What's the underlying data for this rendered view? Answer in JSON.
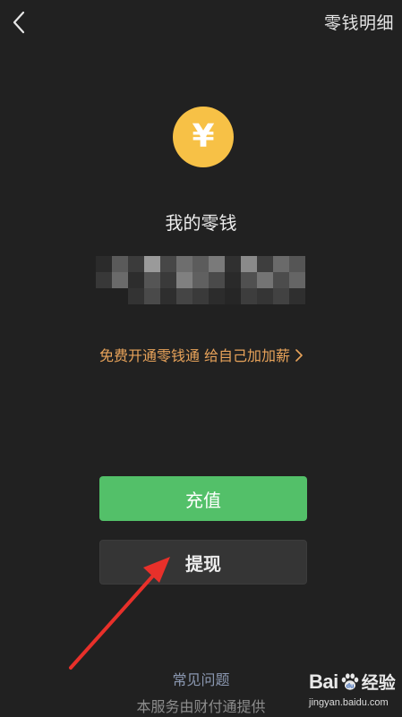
{
  "header": {
    "back_icon": "chevron-left-icon",
    "title": "零钱明细"
  },
  "balance": {
    "coin_symbol": "¥",
    "coin_color": "#f7c146",
    "title": "我的零钱",
    "amount_hidden": true
  },
  "promo": {
    "text": "免费开通零钱通 给自己加加薪",
    "chevron": "›",
    "color": "#e8a35a"
  },
  "actions": {
    "recharge_label": "充值",
    "withdraw_label": "提现",
    "recharge_color": "#53c069"
  },
  "annotation": {
    "arrow_color": "#e8302a",
    "target": "withdraw-button"
  },
  "footer": {
    "faq_label": "常见问题",
    "note": "本服务由财付通提供"
  },
  "watermark": {
    "brand_prefix": "Bai",
    "brand_suffix": "经验",
    "url": "jingyan.baidu.com"
  }
}
